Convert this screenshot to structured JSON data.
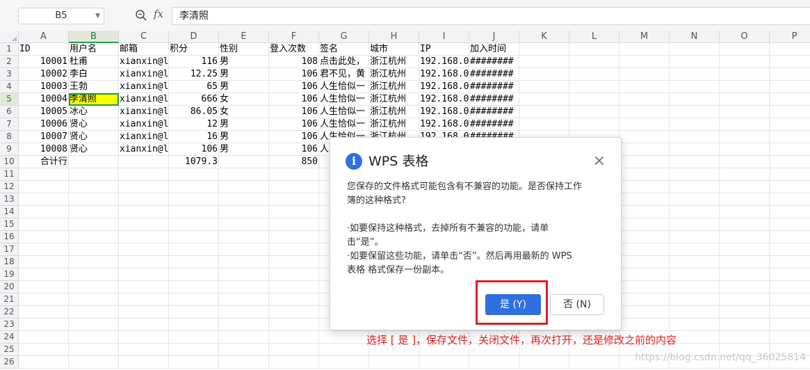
{
  "formula_bar": {
    "name_box": "B5",
    "fx_label": "fx",
    "formula_value": "李清照"
  },
  "columns": [
    "A",
    "B",
    "C",
    "D",
    "E",
    "F",
    "G",
    "H",
    "I",
    "J",
    "K",
    "L",
    "M",
    "N",
    "O",
    "P"
  ],
  "row_numbers": [
    "1",
    "2",
    "3",
    "4",
    "5",
    "6",
    "7",
    "8",
    "9",
    "10",
    "11",
    "12",
    "13",
    "14",
    "15",
    "16",
    "17",
    "18",
    "19",
    "20",
    "21",
    "22",
    "23",
    "24",
    "25",
    "26"
  ],
  "selected_cell": {
    "column": "B",
    "row": "5"
  },
  "cells": [
    [
      "ID",
      "用户名",
      "邮箱",
      "积分",
      "性别",
      "登入次数",
      "签名",
      "城市",
      "IP",
      "加入时间"
    ],
    [
      "10001",
      "杜甫",
      "xianxin@l",
      "116",
      "男",
      "108",
      "点击此处，",
      "浙江杭州",
      "192.168.0",
      "########"
    ],
    [
      "10002",
      "李白",
      "xianxin@l",
      "12.25",
      "男",
      "106",
      "君不见，黄",
      "浙江杭州",
      "192.168.0",
      "########"
    ],
    [
      "10003",
      "王勃",
      "xianxin@l",
      "65",
      "男",
      "106",
      "人生恰似一",
      "浙江杭州",
      "192.168.0",
      "########"
    ],
    [
      "10004",
      "李清照",
      "xianxin@l",
      "666",
      "女",
      "106",
      "人生恰似一",
      "浙江杭州",
      "192.168.0",
      "########"
    ],
    [
      "10005",
      "冰心",
      "xianxin@l",
      "86.05",
      "女",
      "106",
      "人生恰似一",
      "浙江杭州",
      "192.168.0",
      "########"
    ],
    [
      "10006",
      "贤心",
      "xianxin@l",
      "12",
      "男",
      "106",
      "人生恰似一",
      "浙江杭州",
      "192.168.0",
      "########"
    ],
    [
      "10007",
      "贤心",
      "xianxin@l",
      "16",
      "男",
      "106",
      "人生恰似一",
      "浙江杭州",
      "192.168.0",
      "########"
    ],
    [
      "10008",
      "贤心",
      "xianxin@l",
      "106",
      "男",
      "106",
      "人",
      "",
      "",
      ""
    ],
    [
      "合计行",
      "",
      "",
      "1079.3",
      "",
      "850",
      "",
      "",
      "",
      ""
    ]
  ],
  "numeric_columns": [
    0,
    3,
    5
  ],
  "dialog": {
    "title": "WPS 表格",
    "info_icon": "i",
    "close_icon": "×",
    "message_line1": "您保存的文件格式可能包含有不兼容的功能。是否保持工作",
    "message_line2": "簿的这种格式?",
    "option1_line1": "·如要保持这种格式，去掉所有不兼容的功能，请单",
    "option1_line2": "击“是”。",
    "option2_line1": "·如要保留这些功能，请单击“否”。然后再用最新的 WPS",
    "option2_line2": "表格 格式保存一份副本。",
    "yes_label": "是 (Y)",
    "no_label": "否 (N)"
  },
  "annotation": "选择 [ 是 ]，保存文件，关闭文件，再次打开，还是修改之前的内容",
  "watermark": "https://blog.csdn.net/qq_36025814",
  "colors": {
    "selected_cell_fill": "#ffff00",
    "selection_border": "#1f9d48",
    "primary_button": "#2f6fe0",
    "annotation_red": "#e02020"
  }
}
